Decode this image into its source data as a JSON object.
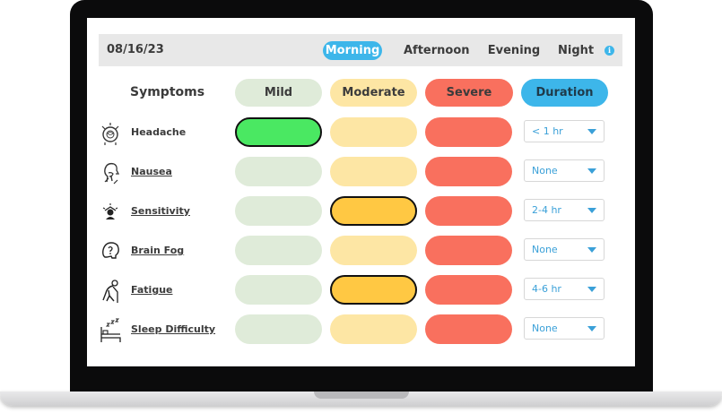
{
  "header": {
    "date": "08/16/23",
    "tabs": [
      {
        "label": "Morning",
        "active": true
      },
      {
        "label": "Afternoon",
        "active": false
      },
      {
        "label": "Evening",
        "active": false
      },
      {
        "label": "Night",
        "active": false
      }
    ]
  },
  "columns": {
    "symptoms": "Symptoms",
    "mild": "Mild",
    "moderate": "Moderate",
    "severe": "Severe",
    "duration": "Duration"
  },
  "colors": {
    "mild_bg": "#dfebd9",
    "mild_selected": "#4ae862",
    "moderate_bg": "#fde6a4",
    "moderate_selected": "#ffc843",
    "severe_bg": "#f9705e",
    "duration_bg": "#3db6ea",
    "accent": "#3db6ea"
  },
  "rows": [
    {
      "label": "Headache",
      "icon": "headache-icon",
      "link": false,
      "selected": "mild",
      "duration": "< 1 hr"
    },
    {
      "label": "Nausea",
      "icon": "nausea-icon",
      "link": true,
      "selected": "",
      "duration": "None"
    },
    {
      "label": "Sensitivity",
      "icon": "sensitivity-icon",
      "link": true,
      "selected": "moderate",
      "duration": "2-4 hr"
    },
    {
      "label": "Brain Fog",
      "icon": "brain-fog-icon",
      "link": true,
      "selected": "",
      "duration": "None"
    },
    {
      "label": "Fatigue",
      "icon": "fatigue-icon",
      "link": true,
      "selected": "moderate",
      "duration": "4-6 hr"
    },
    {
      "label": "Sleep Difficulty",
      "icon": "sleep-difficulty-icon",
      "link": true,
      "selected": "",
      "duration": "None"
    }
  ]
}
